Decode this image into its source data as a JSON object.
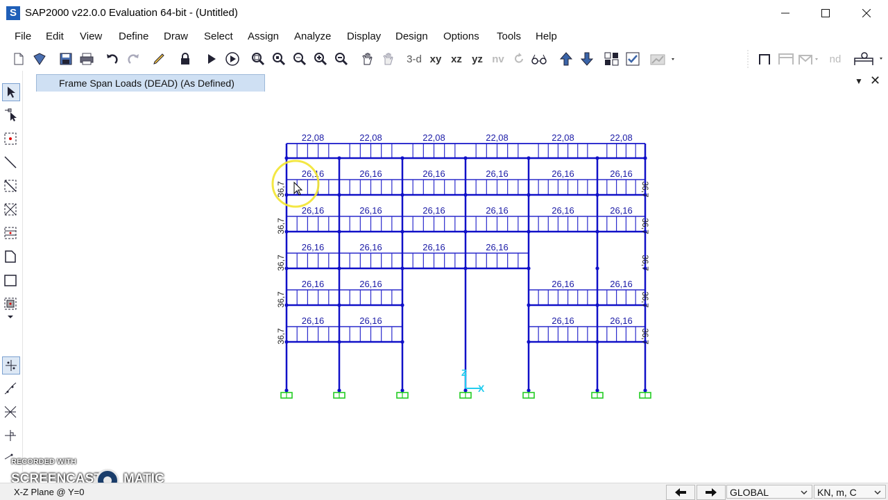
{
  "window": {
    "title": "SAP2000 v22.0.0 Evaluation 64-bit - (Untitled)",
    "app_icon_letter": "S"
  },
  "menu": [
    "File",
    "Edit",
    "View",
    "Define",
    "Draw",
    "Select",
    "Assign",
    "Analyze",
    "Display",
    "Design",
    "Options",
    "Tools",
    "Help"
  ],
  "toolbar": {
    "view_3d": "3-d",
    "view_xy": "xy",
    "view_xz": "xz",
    "view_yz": "yz",
    "view_nv": "nv",
    "nd_label": "nd"
  },
  "tab": {
    "title": "Frame Span Loads (DEAD) (As Defined)",
    "menu_glyph": "▼",
    "close_glyph": "✕"
  },
  "colors": {
    "frame": "#1010c8",
    "load_line": "#2a2acc",
    "label": "#1a1aa6",
    "support": "#22cc22",
    "axis": "#22ccee",
    "highlight_ring": "#f2e430"
  },
  "model": {
    "top_load": "22,08",
    "floor_load": "26,16",
    "side_load": "36,7",
    "axis_x": "X",
    "axis_z": "Z",
    "bays_top": [
      {
        "label": "22,08"
      },
      {
        "label": "22,08"
      },
      {
        "label": "22,08"
      },
      {
        "label": "22,08"
      },
      {
        "label": "22,08"
      },
      {
        "label": "22,08"
      }
    ]
  },
  "status": {
    "plane": "X-Z Plane @ Y=0",
    "coord_system": "GLOBAL",
    "units": "KN, m, C"
  },
  "watermark": {
    "line1": "RECORDED WITH",
    "line2a": "SCREENCAST",
    "line2b": "MATIC"
  }
}
